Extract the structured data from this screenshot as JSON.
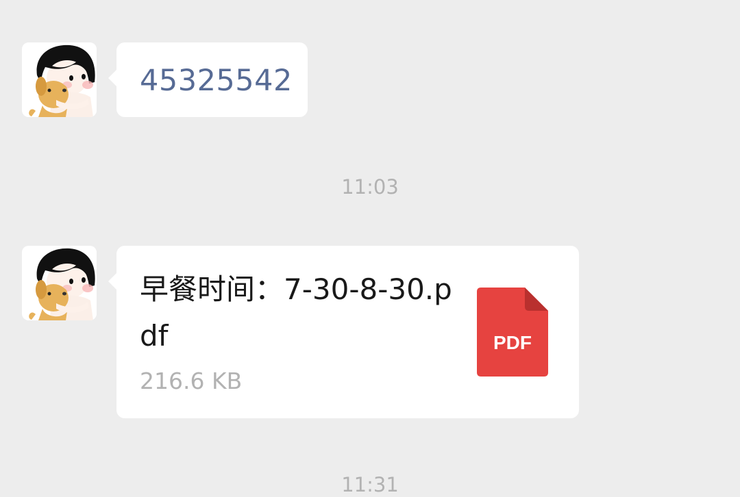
{
  "messages": [
    {
      "type": "text",
      "sender_avatar": "avatar-girl-with-dog",
      "text": "45325542"
    },
    {
      "type": "timestamp",
      "time": "11:03"
    },
    {
      "type": "file",
      "sender_avatar": "avatar-girl-with-dog",
      "file_name": "早餐时间：7-30-8-30.pdf",
      "file_size": "216.6 KB",
      "file_icon": "pdf-file-icon",
      "file_icon_label": "PDF"
    },
    {
      "type": "timestamp",
      "time": "11:31"
    }
  ],
  "colors": {
    "background": "#ededed",
    "bubble": "#ffffff",
    "link_text": "#576b95",
    "timestamp": "#b2b2b2",
    "pdf_icon": "#e64340"
  }
}
